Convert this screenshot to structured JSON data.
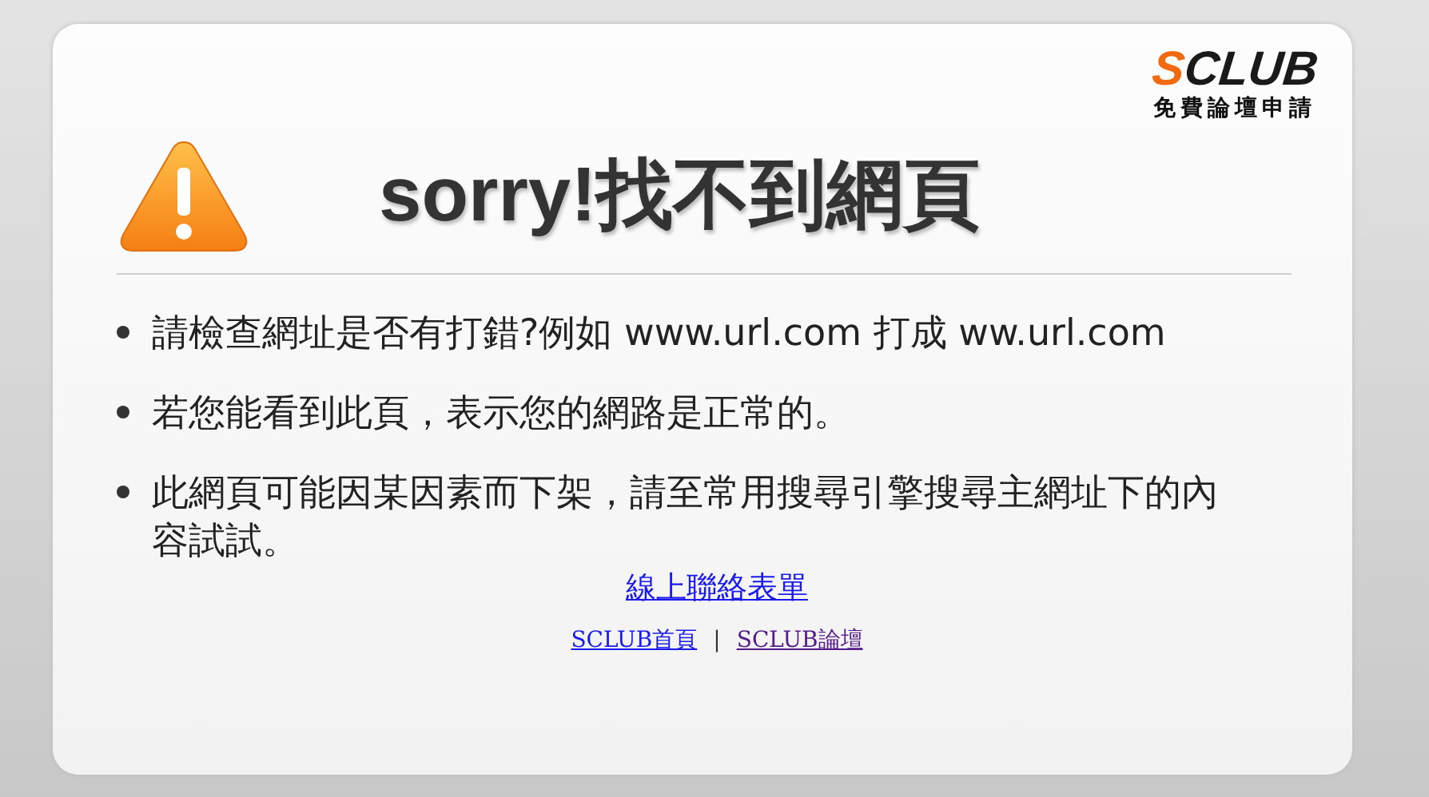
{
  "logo": {
    "accent": "S",
    "rest": "CLUB",
    "tagline": "免費論壇申請"
  },
  "heading": "sorry!找不到網頁",
  "tips": [
    {
      "text": "請檢查網址是否有打錯?例如 www.url.com 打成 ww.url.com"
    },
    {
      "text": "若您能看到此頁，表示您的網路是正常的。"
    },
    {
      "text": "此網頁可能因某因素而下架，請至常用搜尋引擎搜尋主網址下的內容試試。"
    }
  ],
  "contact_link": "線上聯絡表單",
  "footer_links": [
    {
      "label": "SCLUB首頁",
      "visited": false
    },
    {
      "label": "SCLUB論壇",
      "visited": true
    }
  ],
  "separator": "|"
}
